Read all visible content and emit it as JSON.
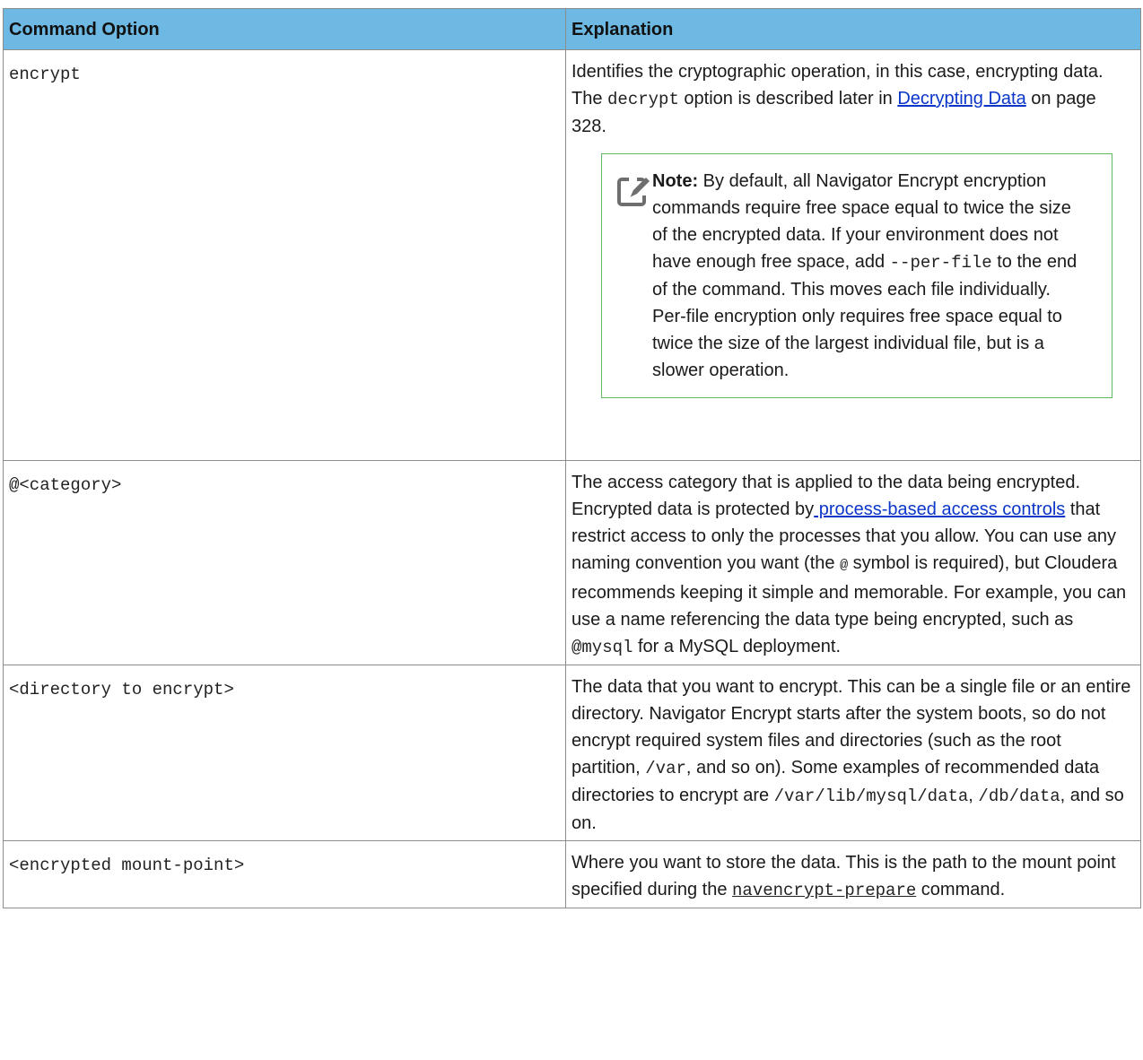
{
  "table": {
    "headers": {
      "option": "Command Option",
      "explanation": "Explanation"
    },
    "rows": [
      {
        "option": "encrypt",
        "explanation": {
          "text_1": "Identifies the cryptographic operation, in this case, encrypting data. The ",
          "code_1": "decrypt",
          "text_2": " option is described later in ",
          "link_1": "Decrypting Data",
          "text_3": " on page 328."
        },
        "note": {
          "label": "Note:",
          "text_1": " By default, all Navigator Encrypt encryption commands require free space equal to twice the size of the encrypted data. If your environment does not have enough free space, add ",
          "code_1": "--per-file",
          "text_2": " to the end of the command. This moves each file individually. Per-file encryption only requires free space equal to twice the size of the largest individual file, but is a slower operation."
        }
      },
      {
        "option": "@<category>",
        "explanation": {
          "text_1": "The access category that is applied to the data being encrypted. Encrypted data is protected by",
          "link_1": " process-based access controls",
          "text_2": " that restrict access to only the processes that you allow. You can use any naming convention you want (the ",
          "code_1": "@",
          "text_3": " symbol is required), but Cloudera recommends keeping it simple and memorable. For example, you can use a name referencing the data type being encrypted, such as ",
          "code_2": "@mysql",
          "text_4": " for a MySQL deployment."
        }
      },
      {
        "option": "<directory to encrypt>",
        "explanation": {
          "text_1": "The data that you want to encrypt. This can be a single file or an entire directory. Navigator Encrypt starts after the system boots, so do not encrypt required system files and directories (such as the root partition, ",
          "code_1": "/var",
          "text_2": ", and so on). Some examples of recommended data directories to encrypt are ",
          "code_2": "/var/lib/mysql/data",
          "text_3": ", ",
          "code_3": "/db/data",
          "text_4": ", and so on."
        }
      },
      {
        "option": "<encrypted mount-point>",
        "explanation": {
          "text_1": "Where you want to store the data. This is the path to the mount point specified during the ",
          "link_1": "navencrypt-prepare",
          "text_2": " command."
        }
      }
    ]
  },
  "icons": {
    "note": "note-pencil-icon"
  },
  "colors": {
    "header_bg": "#6db9e3",
    "link": "#0b36c9",
    "note_border": "#5fb85f",
    "border": "#8d8d8d"
  }
}
